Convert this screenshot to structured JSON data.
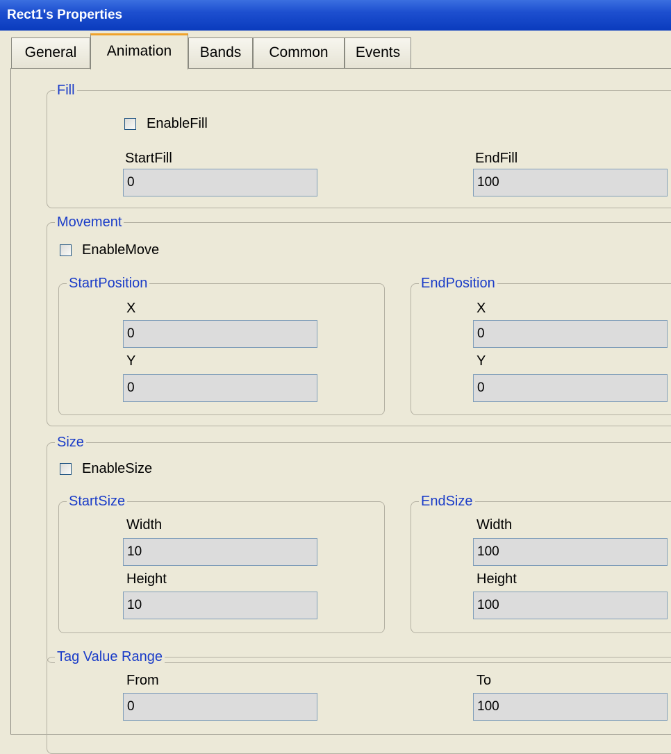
{
  "window": {
    "title": "Rect1's Properties"
  },
  "tabs": [
    "General",
    "Animation",
    "Bands",
    "Common",
    "Events"
  ],
  "fill": {
    "legend": "Fill",
    "enable_label": "EnableFill",
    "enabled": false,
    "start_label": "StartFill",
    "start_value": "0",
    "end_label": "EndFill",
    "end_value": "100"
  },
  "movement": {
    "legend": "Movement",
    "enable_label": "EnableMove",
    "enabled": false,
    "start": {
      "legend": "StartPosition",
      "x_label": "X",
      "x_value": "0",
      "y_label": "Y",
      "y_value": "0"
    },
    "end": {
      "legend": "EndPosition",
      "x_label": "X",
      "x_value": "0",
      "y_label": "Y",
      "y_value": "0"
    }
  },
  "size": {
    "legend": "Size",
    "enable_label": "EnableSize",
    "enabled": false,
    "start": {
      "legend": "StartSize",
      "width_label": "Width",
      "width_value": "10",
      "height_label": "Height",
      "height_value": "10"
    },
    "end": {
      "legend": "EndSize",
      "width_label": "Width",
      "width_value": "100",
      "height_label": "Height",
      "height_value": "100"
    }
  },
  "tag_range": {
    "legend": "Tag Value Range",
    "from_label": "From",
    "from_value": "0",
    "to_label": "To",
    "to_value": "100"
  },
  "colors": {
    "title_bar": "#0a3bbd",
    "legend_text": "#1a3cc8",
    "active_tab_accent": "#f0a22a",
    "dialog_bg": "#ece9d8"
  }
}
